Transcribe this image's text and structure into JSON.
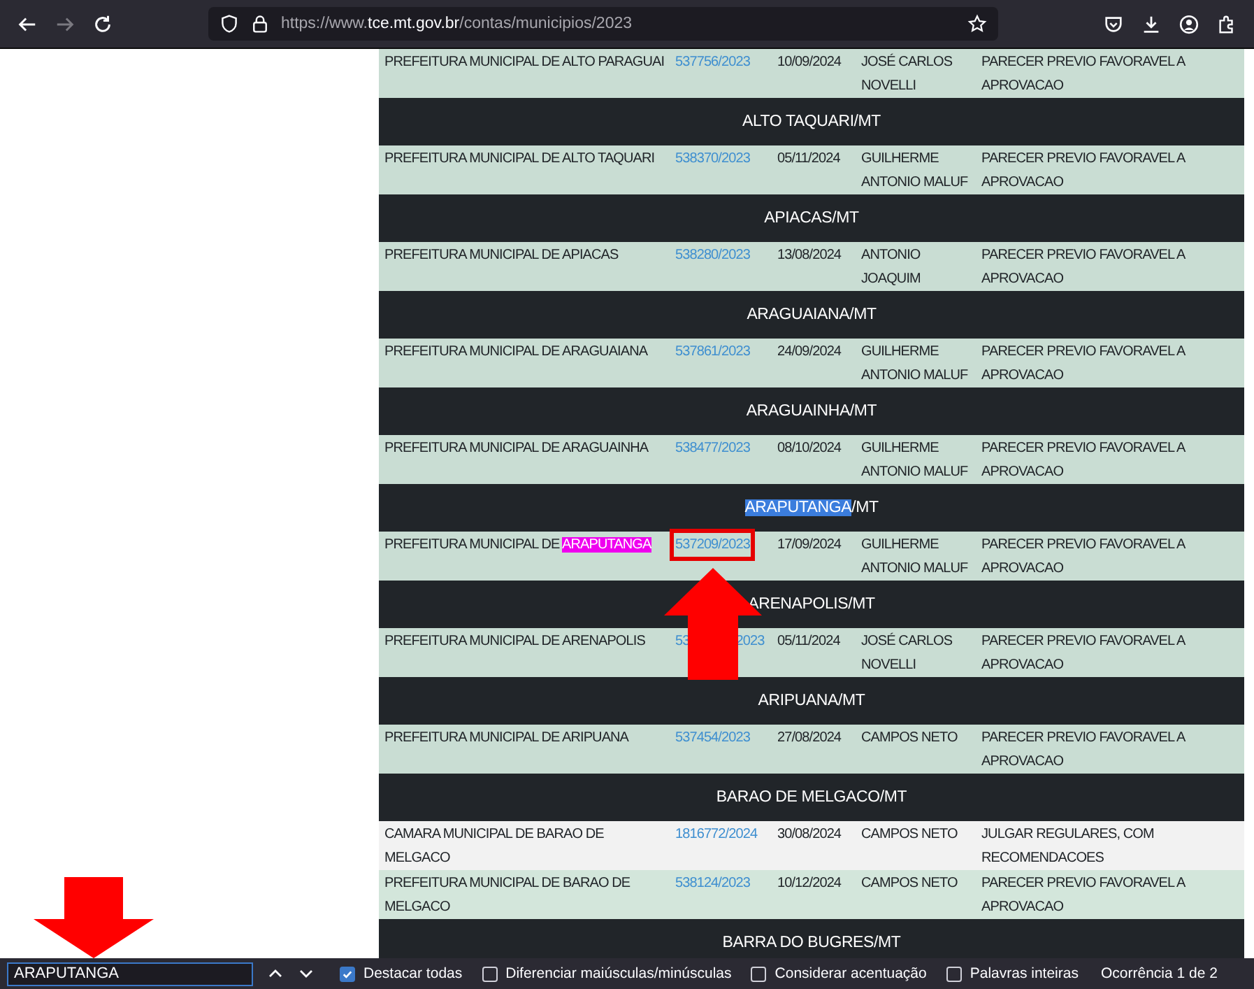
{
  "browser": {
    "url_prefix": "https://www.",
    "url_domain": "tce.mt.gov.br",
    "url_path": "/contas/municipios/2023",
    "forward_disabled": true
  },
  "groups": [
    {
      "rows": [
        {
          "entity": [
            {
              "text": "PREFEITURA MUNICIPAL DE ALTO PARAGUAI"
            }
          ],
          "process": "537756/2023",
          "date": "10/09/2024",
          "relator": "JOSÉ CARLOS NOVELLI",
          "result": "PARECER PREVIO FAVORAVEL A APROVACAO",
          "color": "#c9ddd3"
        }
      ]
    },
    {
      "heading": [
        {
          "text": "ALTO TAQUARI/MT"
        }
      ],
      "rows": [
        {
          "entity": [
            {
              "text": "PREFEITURA MUNICIPAL DE ALTO TAQUARI"
            }
          ],
          "process": "538370/2023",
          "date": "05/11/2024",
          "relator": "GUILHERME ANTONIO MALUF",
          "result": "PARECER PREVIO FAVORAVEL A APROVACAO",
          "color": "#c9ddd3"
        }
      ]
    },
    {
      "heading": [
        {
          "text": "APIACAS/MT"
        }
      ],
      "rows": [
        {
          "entity": [
            {
              "text": "PREFEITURA MUNICIPAL DE APIACAS"
            }
          ],
          "process": "538280/2023",
          "date": "13/08/2024",
          "relator": "ANTONIO JOAQUIM",
          "result": "PARECER PREVIO FAVORAVEL A APROVACAO",
          "color": "#c9ddd3"
        }
      ]
    },
    {
      "heading": [
        {
          "text": "ARAGUAIANA/MT"
        }
      ],
      "rows": [
        {
          "entity": [
            {
              "text": "PREFEITURA MUNICIPAL DE ARAGUAIANA"
            }
          ],
          "process": "537861/2023",
          "date": "24/09/2024",
          "relator": "GUILHERME ANTONIO MALUF",
          "result": "PARECER PREVIO FAVORAVEL A APROVACAO",
          "color": "#c9ddd3"
        }
      ]
    },
    {
      "heading": [
        {
          "text": "ARAGUAINHA/MT"
        }
      ],
      "rows": [
        {
          "entity": [
            {
              "text": "PREFEITURA MUNICIPAL DE ARAGUAINHA"
            }
          ],
          "process": "538477/2023",
          "date": "08/10/2024",
          "relator": "GUILHERME ANTONIO MALUF",
          "result": "PARECER PREVIO FAVORAVEL A APROVACAO",
          "color": "#c9ddd3"
        }
      ]
    },
    {
      "heading": [
        {
          "text": "ARAPUTANGA",
          "selected": true
        },
        {
          "text": "/MT"
        }
      ],
      "rows": [
        {
          "entity": [
            {
              "text": "PREFEITURA MUNICIPAL DE "
            },
            {
              "text": "ARAPUTANGA",
              "highlighted": true
            }
          ],
          "process": "537209/2023",
          "boxed": true,
          "date": "17/09/2024",
          "relator": "GUILHERME ANTONIO MALUF",
          "result": "PARECER PREVIO FAVORAVEL A APROVACAO",
          "color": "#c9ddd3"
        }
      ]
    },
    {
      "heading": [
        {
          "text": "ARENAPOLIS/MT"
        }
      ],
      "rows": [
        {
          "entity": [
            {
              "text": "PREFEITURA MUNICIPAL DE ARENAPOLIS"
            }
          ],
          "process": "53",
          "process_after_cover": "2023",
          "date": "05/11/2024",
          "relator": "JOSÉ CARLOS NOVELLI",
          "result": "PARECER PREVIO FAVORAVEL A APROVACAO",
          "color": "#c9ddd3"
        }
      ]
    },
    {
      "heading": [
        {
          "text": "ARIPUANA/MT"
        }
      ],
      "rows": [
        {
          "entity": [
            {
              "text": "PREFEITURA MUNICIPAL DE ARIPUANA"
            }
          ],
          "process": "537454/2023",
          "date": "27/08/2024",
          "relator": "CAMPOS NETO",
          "result": "PARECER PREVIO FAVORAVEL A APROVACAO",
          "color": "#c9ddd3"
        }
      ]
    },
    {
      "heading": [
        {
          "text": "BARAO DE MELGACO/MT"
        }
      ],
      "rows": [
        {
          "entity": [
            {
              "text": "CAMARA MUNICIPAL DE BARAO DE MELGACO"
            }
          ],
          "process": "1816772/2024",
          "date": "30/08/2024",
          "relator": "CAMPOS NETO",
          "result": "JULGAR REGULARES, COM RECOMENDACOES",
          "color": "#f2f2f2"
        },
        {
          "entity": [
            {
              "text": "PREFEITURA MUNICIPAL DE BARAO DE MELGACO"
            }
          ],
          "process": "538124/2023",
          "date": "10/12/2024",
          "relator": "CAMPOS NETO",
          "result": "PARECER PREVIO FAVORAVEL A APROVACAO",
          "color": "#d3e6db"
        }
      ]
    },
    {
      "heading": [
        {
          "text": "BARRA DO BUGRES/MT"
        }
      ]
    }
  ],
  "find_bar": {
    "value": "ARAPUTANGA",
    "options": [
      {
        "label": "Destacar todas",
        "checked": true
      },
      {
        "label": "Diferenciar maiúsculas/minúsculas",
        "checked": false
      },
      {
        "label": "Considerar acentuação",
        "checked": false
      },
      {
        "label": "Palavras inteiras",
        "checked": false
      }
    ],
    "status": "Ocorrência 1 de 2"
  }
}
